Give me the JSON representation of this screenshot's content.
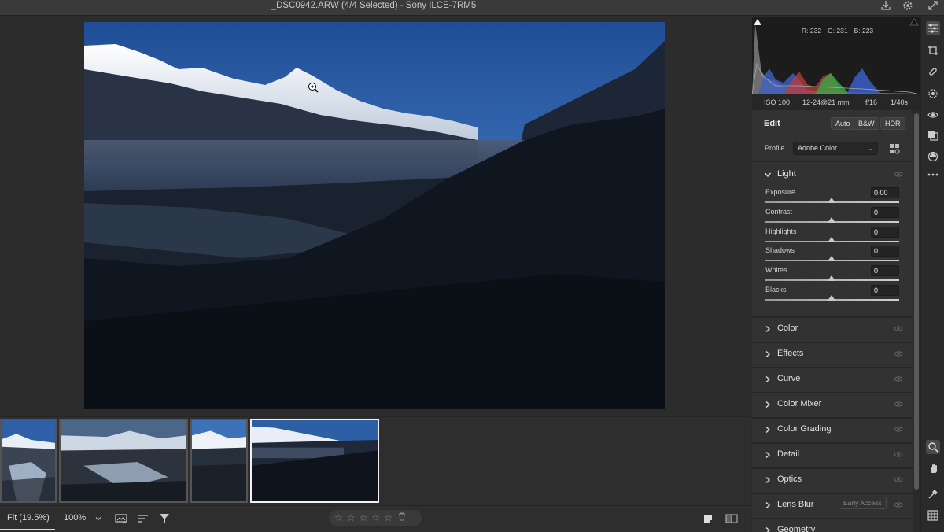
{
  "window": {
    "title": "_DSC0942.ARW (4/4 Selected)  -  Sony ILCE-7RM5"
  },
  "histogram": {
    "r": "R: 232",
    "g": "G: 231",
    "b": "B: 223"
  },
  "exif": {
    "iso": "ISO 100",
    "lens": "12-24@21 mm",
    "aperture": "f/16",
    "shutter": "1/40s"
  },
  "edit": {
    "title": "Edit",
    "buttons": [
      "Auto",
      "B&W",
      "HDR"
    ],
    "profile_label": "Profile",
    "profile_value": "Adobe Color"
  },
  "light": {
    "label": "Light",
    "sliders": [
      {
        "label": "Exposure",
        "value": "0.00"
      },
      {
        "label": "Contrast",
        "value": "0"
      },
      {
        "label": "Highlights",
        "value": "0"
      },
      {
        "label": "Shadows",
        "value": "0"
      },
      {
        "label": "Whites",
        "value": "0"
      },
      {
        "label": "Blacks",
        "value": "0"
      }
    ]
  },
  "sections": [
    {
      "label": "Color"
    },
    {
      "label": "Effects"
    },
    {
      "label": "Curve"
    },
    {
      "label": "Color Mixer"
    },
    {
      "label": "Color Grading"
    },
    {
      "label": "Detail"
    },
    {
      "label": "Optics"
    },
    {
      "label": "Lens Blur",
      "extra": "Early Access"
    },
    {
      "label": "Geometry"
    }
  ],
  "bottom": {
    "fit": "Fit (19.5%)",
    "zoom": "100%",
    "stars": [
      "☆",
      "☆",
      "☆",
      "☆",
      "☆"
    ]
  },
  "icons": [
    "export-icon",
    "gear-icon",
    "expand-icon",
    "sliders-icon",
    "crop-icon",
    "heal-icon",
    "masking-icon",
    "redeye-icon",
    "presets-icon",
    "snapshots-icon",
    "more-icon",
    "zoom-tool-icon",
    "hand-tool-icon",
    "color-sampler-icon",
    "grid-icon"
  ]
}
